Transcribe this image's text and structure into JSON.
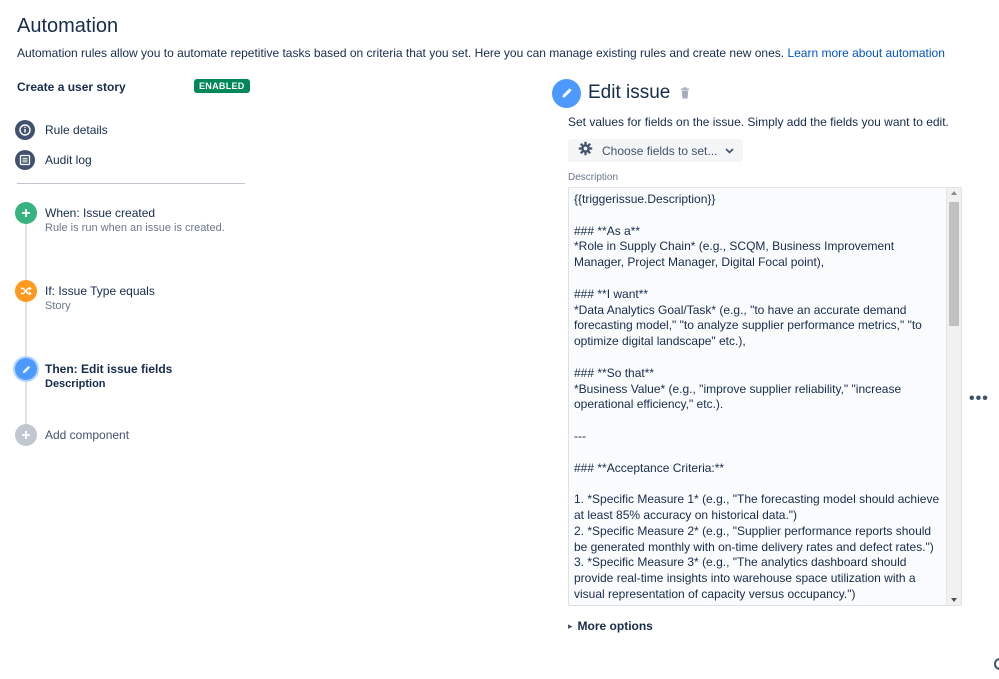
{
  "page": {
    "title": "Automation",
    "intro": "Automation rules allow you to automate repetitive tasks based on criteria that you set. Here you can manage existing rules and create new ones.",
    "learn_more": "Learn more about automation"
  },
  "rule": {
    "name": "Create a user story",
    "status": "ENABLED",
    "status_color": "#00875a"
  },
  "nav": {
    "rule_details": "Rule details",
    "audit_log": "Audit log"
  },
  "steps": {
    "trigger": {
      "title": "When: Issue created",
      "subtitle": "Rule is run when an issue is created.",
      "icon": "plus-icon",
      "color": "#36b37e"
    },
    "condition": {
      "title": "If: Issue Type equals",
      "subtitle": "Story",
      "icon": "shuffle-icon",
      "color": "#ff991f"
    },
    "action": {
      "title": "Then: Edit issue fields",
      "subtitle": "Description",
      "icon": "pencil-icon",
      "color": "#4c9aff"
    },
    "add": {
      "title": "Add component",
      "icon": "plus-icon",
      "color": "#c1c7d0"
    }
  },
  "editor": {
    "title": "Edit issue",
    "description": "Set values for fields on the issue. Simply add the fields you want to edit.",
    "choose_fields": "Choose fields to set...",
    "field_label": "Description",
    "description_value": "{{triggerissue.Description}}\n\n### **As a**\n*Role in Supply Chain* (e.g., SCQM, Business Improvement Manager, Project Manager, Digital Focal point),\n\n### **I want**\n*Data Analytics Goal/Task* (e.g., \"to have an accurate demand forecasting model,\" \"to analyze supplier performance metrics,\" \"to optimize digital landscape\" etc.),\n\n### **So that**\n*Business Value* (e.g., \"improve supplier reliability,\" \"increase operational efficiency,\" etc.).\n\n---\n\n### **Acceptance Criteria:**\n\n1. *Specific Measure 1* (e.g., \"The forecasting model should achieve at least 85% accuracy on historical data.\")\n2. *Specific Measure 2* (e.g., \"Supplier performance reports should be generated monthly with on-time delivery rates and defect rates.\")\n3. *Specific Measure 3* (e.g., \"The analytics dashboard should provide real-time insights into warehouse space utilization with a visual representation of capacity versus occupancy.\")",
    "more_options": "More options"
  },
  "colors": {
    "link": "#0052cc",
    "text": "#172b4d",
    "muted": "#6b778c"
  }
}
